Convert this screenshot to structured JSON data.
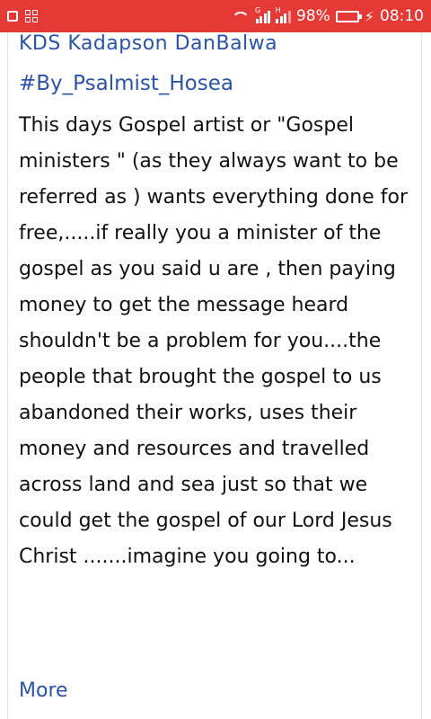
{
  "status_bar": {
    "signal_1_label": "G",
    "signal_2_label": "H",
    "battery_percent": "98%",
    "time": "08:10"
  },
  "post": {
    "author_name": "KDS Kadapson DanBalwa",
    "hashtag": "#By_Psalmist_Hosea",
    "body": "This days Gospel artist or \"Gospel ministers \" (as they always want to be referred as ) wants everything done for free,.....if really you a minister of the gospel as you said u are , then paying money to get the message heard shouldn't be a problem for you....the people that brought the gospel to us abandoned their works, uses their money and resources and travelled across land and sea just so that we could get the gospel of our Lord Jesus Christ .......imagine you going to...",
    "more_label": "More"
  }
}
